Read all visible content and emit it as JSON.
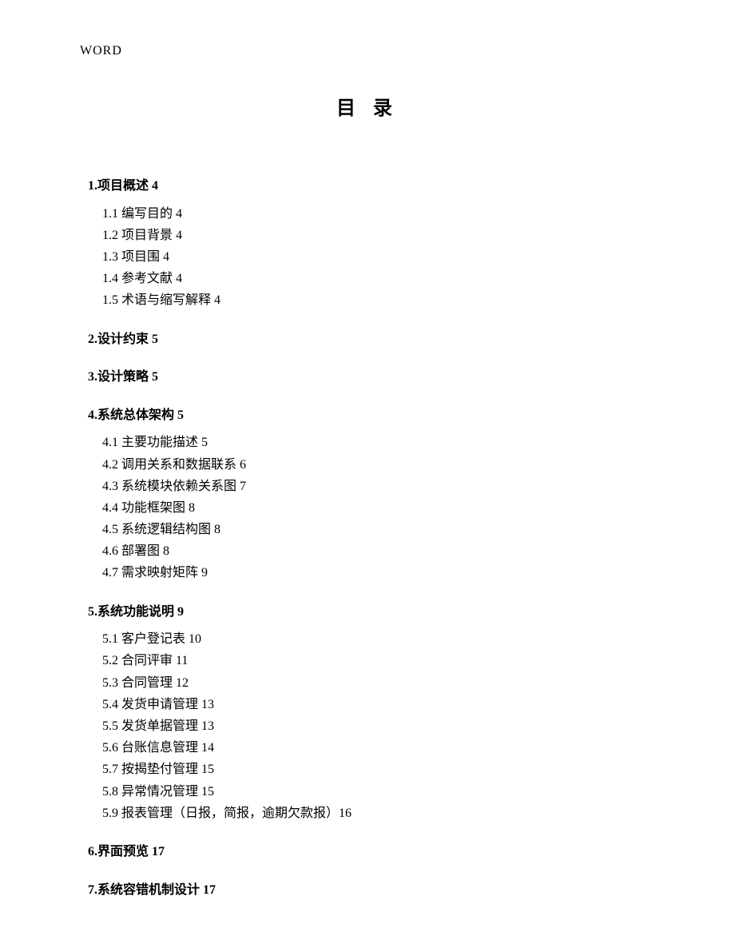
{
  "header": "WORD",
  "title": "目 录",
  "sections": [
    {
      "label": "1.项目概述 4",
      "subs": [
        "1.1 编写目的 4",
        "1.2 项目背景 4",
        "1.3 项目围 4",
        "1.4 参考文献 4",
        "1.5 术语与缩写解释 4"
      ]
    },
    {
      "label": "2.设计约束 5",
      "subs": []
    },
    {
      "label": "3.设计策略 5",
      "subs": []
    },
    {
      "label": "4.系统总体架构 5",
      "subs": [
        "4.1 主要功能描述 5",
        "4.2 调用关系和数据联系 6",
        "4.3 系统模块依赖关系图 7",
        "4.4 功能框架图 8",
        "4.5 系统逻辑结构图 8",
        "4.6 部署图 8",
        "4.7 需求映射矩阵 9"
      ]
    },
    {
      "label": "5.系统功能说明 9",
      "subs": [
        "5.1 客户登记表 10",
        "5.2 合同评审 11",
        "5.3 合同管理 12",
        "5.4 发货申请管理 13",
        "5.5 发货单据管理 13",
        "5.6 台账信息管理 14",
        "5.7 按揭垫付管理 15",
        "5.8 异常情况管理 15",
        "5.9 报表管理（日报，简报，逾期欠款报）16"
      ]
    },
    {
      "label": "6.界面预览 17",
      "subs": []
    },
    {
      "label": "7.系统容错机制设计 17",
      "subs": []
    }
  ]
}
